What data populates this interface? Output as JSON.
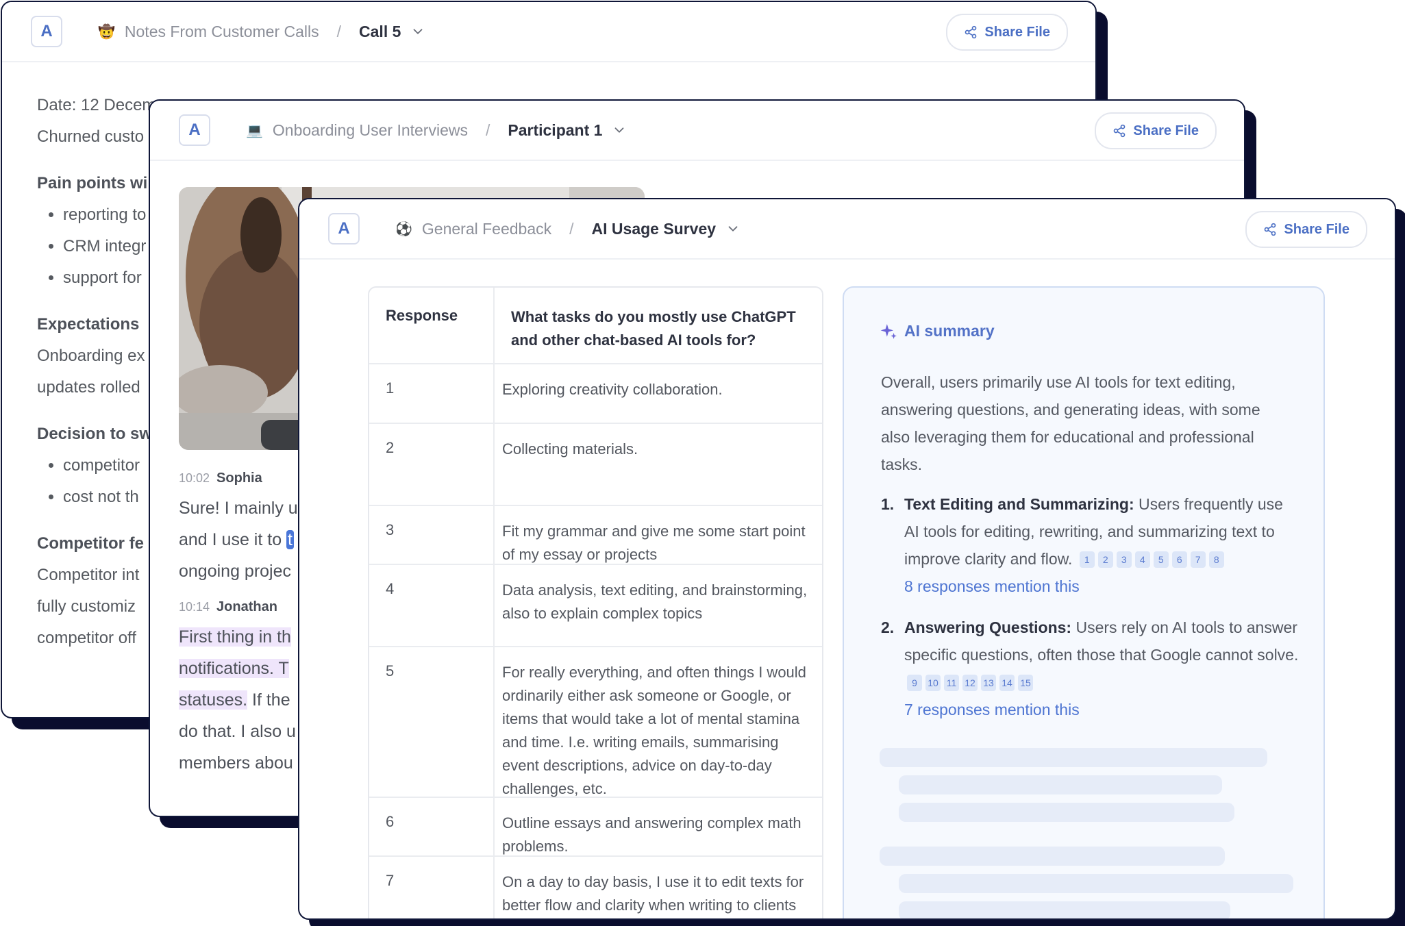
{
  "window1": {
    "logo": "A",
    "breadcrumb": {
      "emoji": "🤠",
      "parent": "Notes From Customer Calls",
      "separator": "/",
      "current": "Call 5"
    },
    "share_label": "Share File",
    "doc": {
      "date": "Date: 12 Decem",
      "line2": "Churned custo",
      "h_pain": "Pain points wi",
      "pain_items": [
        "reporting to",
        "CRM integr",
        "support for"
      ],
      "h_expect": "Expectations",
      "expect_lines": [
        "Onboarding ex",
        "updates rolled"
      ],
      "h_decision": "Decision to sw",
      "decision_items": [
        "competitor",
        "cost not th"
      ],
      "h_competitor": "Competitor fe",
      "competitor_lines": [
        "Competitor int",
        "fully customiz",
        "competitor off"
      ]
    }
  },
  "window2": {
    "logo": "A",
    "breadcrumb": {
      "emoji": "💻",
      "parent": "Onboarding User Interviews",
      "separator": "/",
      "current": "Participant 1"
    },
    "share_label": "Share File",
    "transcript": [
      {
        "time": "10:02",
        "speaker": "Sophia",
        "l1": "Sure! I mainly u",
        "l2_pre": "and I use it to ",
        "l2_hl": "t",
        "l3": "ongoing projec"
      },
      {
        "time": "10:14",
        "speaker": "Jonathan",
        "l1": "First thing in th",
        "l2_hl": "notifications. T",
        "l3_hl": "statuses.",
        "l3_rest": " If the",
        "l4": "do that. I also u",
        "l5": "members abou"
      }
    ]
  },
  "window3": {
    "logo": "A",
    "breadcrumb": {
      "emoji": "⚽",
      "parent": "General Feedback",
      "separator": "/",
      "current": "AI Usage Survey"
    },
    "share_label": "Share File",
    "table": {
      "headers": [
        "Response",
        "What tasks do you mostly use ChatGPT and other chat-based AI tools for?"
      ],
      "rows": [
        [
          "1",
          "Exploring creativity collaboration."
        ],
        [
          "2",
          "Collecting materials."
        ],
        [
          "3",
          "Fit my grammar and give me some start point of my essay or projects"
        ],
        [
          "4",
          "Data analysis, text editing, and brainstorming, also to explain complex topics"
        ],
        [
          "5",
          "For really everything, and often things I would ordinarily either ask someone or Google, or items that would take a lot of mental stamina and time. I.e. writing emails, summarising event descriptions, advice on day-to-day challenges, etc."
        ],
        [
          "6",
          "Outline essays and answering complex math problems."
        ],
        [
          "7",
          "On a day to day basis, I use it to edit texts for better flow and clarity when writing to clients in my job. Also to answer specific"
        ]
      ]
    },
    "summary": {
      "title": "AI summary",
      "overview": "Overall, users primarily use AI tools for text editing, answering questions, and generating ideas, with some also leveraging them for educational and professional tasks.",
      "items": [
        {
          "num": "1.",
          "title": "Text Editing and Summarizing:",
          "text": " Users frequently use AI tools for editing, rewriting, and summarizing text to improve clarity and flow.",
          "refs": [
            "1",
            "2",
            "3",
            "4",
            "5",
            "6",
            "7",
            "8"
          ],
          "mention": "8 responses mention this"
        },
        {
          "num": "2.",
          "title": "Answering Questions:",
          "text": " Users rely on AI tools to answer specific questions, often those that Google cannot solve.",
          "refs": [
            "9",
            "10",
            "11",
            "12",
            "13",
            "14",
            "15"
          ],
          "mention": "7 responses mention this"
        }
      ]
    }
  },
  "icons": {
    "share": "share-icon",
    "chevron": "chevron-down-icon",
    "sparkle": "sparkle-icon"
  },
  "colors": {
    "accent": "#4b6fc4",
    "window_border": "#0f1638",
    "highlight_blue": "#4a76d8",
    "highlight_purple": "#efe5fb"
  }
}
